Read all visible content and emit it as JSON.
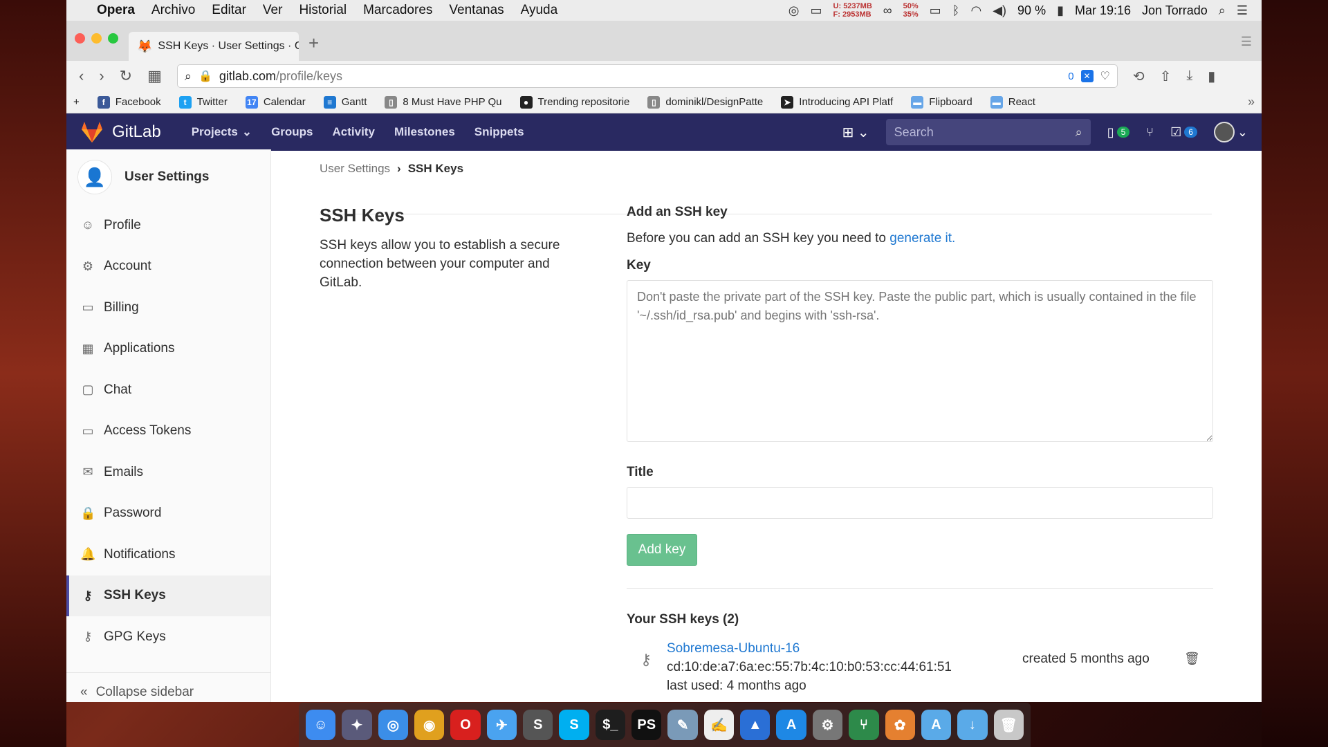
{
  "menubar": {
    "app": "Opera",
    "items": [
      "Archivo",
      "Editar",
      "Ver",
      "Historial",
      "Marcadores",
      "Ventanas",
      "Ayuda"
    ],
    "mem_used": "U: 5237MB",
    "mem_free": "F: 2953MB",
    "cpu_top": "50%",
    "cpu_bottom": "35%",
    "battery": "90 %",
    "clock": "Mar 19:16",
    "user": "Jon Torrado"
  },
  "browser": {
    "tab_title": "SSH Keys · User Settings · Gi",
    "url_host": "gitlab.com",
    "url_path": "/profile/keys",
    "url_badge": "0",
    "bookmarks": [
      {
        "label": "Facebook",
        "icon": "facebook-icon",
        "color": "#3b5998",
        "glyph": "f"
      },
      {
        "label": "Twitter",
        "icon": "twitter-icon",
        "color": "#1da1f2",
        "glyph": "t"
      },
      {
        "label": "Calendar",
        "icon": "calendar-icon",
        "color": "#4285f4",
        "glyph": "17"
      },
      {
        "label": "Gantt",
        "icon": "gantt-icon",
        "color": "#1f78d1",
        "glyph": "≡"
      },
      {
        "label": "8 Must Have PHP Qu",
        "icon": "page-icon",
        "color": "#888888",
        "glyph": "▯"
      },
      {
        "label": "Trending repositorie",
        "icon": "github-icon",
        "color": "#222222",
        "glyph": "●"
      },
      {
        "label": "dominikl/DesignPatte",
        "icon": "page-icon",
        "color": "#888888",
        "glyph": "▯"
      },
      {
        "label": "Introducing API Platf",
        "icon": "api-platform-icon",
        "color": "#222222",
        "glyph": "➤"
      },
      {
        "label": "Flipboard",
        "icon": "folder-icon",
        "color": "#67a6e8",
        "glyph": "▬"
      },
      {
        "label": "React",
        "icon": "folder-icon",
        "color": "#67a6e8",
        "glyph": "▬"
      }
    ]
  },
  "gitlab": {
    "brand": "GitLab",
    "nav": [
      "Projects",
      "Groups",
      "Activity",
      "Milestones",
      "Snippets"
    ],
    "search_placeholder": "Search",
    "issues_count": "5",
    "todos_count": "6"
  },
  "sidebar": {
    "title": "User Settings",
    "items": [
      {
        "label": "Profile",
        "icon": "profile-icon",
        "glyph": "☺"
      },
      {
        "label": "Account",
        "icon": "account-icon",
        "glyph": "⚙"
      },
      {
        "label": "Billing",
        "icon": "billing-icon",
        "glyph": "▭"
      },
      {
        "label": "Applications",
        "icon": "applications-icon",
        "glyph": "▦"
      },
      {
        "label": "Chat",
        "icon": "chat-icon",
        "glyph": "▢"
      },
      {
        "label": "Access Tokens",
        "icon": "access-tokens-icon",
        "glyph": "▭"
      },
      {
        "label": "Emails",
        "icon": "emails-icon",
        "glyph": "✉"
      },
      {
        "label": "Password",
        "icon": "password-icon",
        "glyph": "🔒"
      },
      {
        "label": "Notifications",
        "icon": "notifications-icon",
        "glyph": "🔔"
      },
      {
        "label": "SSH Keys",
        "icon": "key-icon",
        "glyph": "⚷"
      },
      {
        "label": "GPG Keys",
        "icon": "key-icon",
        "glyph": "⚷"
      }
    ],
    "active_index": 9,
    "collapse": "Collapse sidebar"
  },
  "breadcrumb": {
    "parent": "User Settings",
    "current": "SSH Keys"
  },
  "intro": {
    "title": "SSH Keys",
    "description": "SSH keys allow you to establish a secure connection between your computer and GitLab."
  },
  "form": {
    "heading": "Add an SSH key",
    "before_text": "Before you can add an SSH key you need to ",
    "generate_link": "generate it.",
    "key_label": "Key",
    "key_placeholder": "Don't paste the private part of the SSH key. Paste the public part, which is usually contained in the file '~/.ssh/id_rsa.pub' and begins with 'ssh-rsa'.",
    "title_label": "Title",
    "title_value": "",
    "submit": "Add key"
  },
  "keys": {
    "heading": "Your SSH keys (2)",
    "list": [
      {
        "name": "Sobremesa-Ubuntu-16",
        "fingerprint": "cd:10:de:a7:6a:ec:55:7b:4c:10:b0:53:cc:44:61:51",
        "last_used": "last used: 4 months ago",
        "created": "created 5 months ago"
      }
    ]
  },
  "dock": [
    {
      "name": "finder-app",
      "color": "#3d8cf0",
      "glyph": "☺"
    },
    {
      "name": "launchpad-app",
      "color": "#5a5a7a",
      "glyph": "✦"
    },
    {
      "name": "safari-app",
      "color": "#3b8ee8",
      "glyph": "◎"
    },
    {
      "name": "chrome-app",
      "color": "#e0a01e",
      "glyph": "◉"
    },
    {
      "name": "opera-app",
      "color": "#d8201e",
      "glyph": "O"
    },
    {
      "name": "mail-app",
      "color": "#4aa3f0",
      "glyph": "✈"
    },
    {
      "name": "sublime-app",
      "color": "#555555",
      "glyph": "S"
    },
    {
      "name": "skype-app",
      "color": "#00aff0",
      "glyph": "S"
    },
    {
      "name": "terminal-app",
      "color": "#1e1e1e",
      "glyph": "$_"
    },
    {
      "name": "phpstorm-app",
      "color": "#111111",
      "glyph": "PS"
    },
    {
      "name": "preview-app",
      "color": "#7a9ab8",
      "glyph": "✎"
    },
    {
      "name": "textedit-app",
      "color": "#eeeeee",
      "glyph": "✍"
    },
    {
      "name": "keynote-app",
      "color": "#2a6fd6",
      "glyph": "▲"
    },
    {
      "name": "appstore-app",
      "color": "#1e88e5",
      "glyph": "A"
    },
    {
      "name": "preferences-app",
      "color": "#777777",
      "glyph": "⚙"
    },
    {
      "name": "sourcetree-app",
      "color": "#2d8a4a",
      "glyph": "⑂"
    },
    {
      "name": "flower-app",
      "color": "#e58030",
      "glyph": "✿"
    },
    {
      "name": "apps-folder",
      "color": "#5aaae8",
      "glyph": "A"
    },
    {
      "name": "downloads-folder",
      "color": "#5aaae8",
      "glyph": "↓"
    },
    {
      "name": "trash-app",
      "color": "#c8c8c8",
      "glyph": "🗑"
    }
  ]
}
